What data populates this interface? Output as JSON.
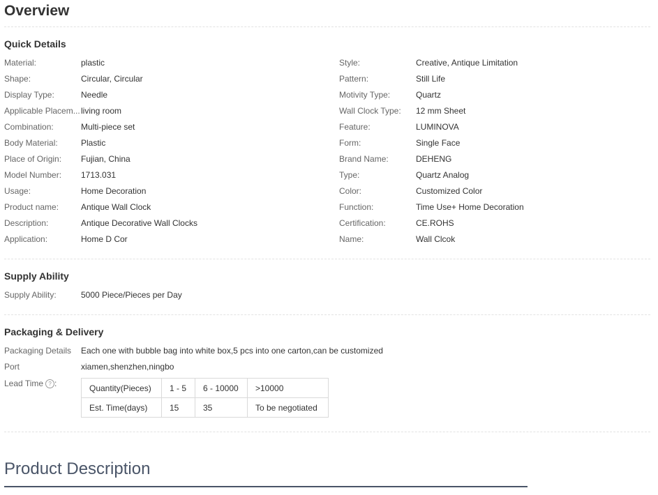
{
  "overview": {
    "title": "Overview"
  },
  "quick_details": {
    "title": "Quick Details",
    "left": [
      {
        "label": "Material:",
        "value": "plastic"
      },
      {
        "label": "Shape:",
        "value": "Circular, Circular"
      },
      {
        "label": "Display Type:",
        "value": "Needle"
      },
      {
        "label": "Applicable Placem...",
        "value": "living room"
      },
      {
        "label": "Combination:",
        "value": "Multi-piece set"
      },
      {
        "label": "Body Material:",
        "value": "Plastic"
      },
      {
        "label": "Place of Origin:",
        "value": "Fujian, China"
      },
      {
        "label": "Model Number:",
        "value": "1713.031"
      },
      {
        "label": "Usage:",
        "value": "Home Decoration"
      },
      {
        "label": "Product name:",
        "value": "Antique Wall Clock"
      },
      {
        "label": "Description:",
        "value": "Antique Decorative Wall Clocks"
      },
      {
        "label": "Application:",
        "value": "Home D Cor"
      }
    ],
    "right": [
      {
        "label": "Style:",
        "value": "Creative, Antique Limitation"
      },
      {
        "label": "Pattern:",
        "value": "Still Life"
      },
      {
        "label": "Motivity Type:",
        "value": "Quartz"
      },
      {
        "label": "Wall Clock Type:",
        "value": "12 mm Sheet"
      },
      {
        "label": "Feature:",
        "value": "LUMINOVA"
      },
      {
        "label": "Form:",
        "value": "Single Face"
      },
      {
        "label": "Brand Name:",
        "value": "DEHENG"
      },
      {
        "label": "Type:",
        "value": "Quartz Analog"
      },
      {
        "label": "Color:",
        "value": "Customized Color"
      },
      {
        "label": "Function:",
        "value": "Time Use+ Home Decoration"
      },
      {
        "label": "Certification:",
        "value": "CE.ROHS"
      },
      {
        "label": "Name:",
        "value": "Wall Clcok"
      }
    ]
  },
  "supply": {
    "title": "Supply Ability",
    "label": "Supply Ability:",
    "value": "5000 Piece/Pieces per Day"
  },
  "packaging": {
    "title": "Packaging & Delivery",
    "details_label": "Packaging Details",
    "details_value": "Each one with bubble bag into white box,5 pcs into one carton,can be customized",
    "port_label": "Port",
    "port_value": "xiamen,shenzhen,ningbo",
    "lead_label": "Lead Time",
    "lead_colon": ":",
    "help_icon_char": "?",
    "lead_table": [
      [
        "Quantity(Pieces)",
        "1 - 5",
        "6 - 10000",
        ">10000"
      ],
      [
        "Est. Time(days)",
        "15",
        "35",
        "To be negotiated"
      ]
    ]
  },
  "product_description": {
    "title": "Product Description"
  }
}
